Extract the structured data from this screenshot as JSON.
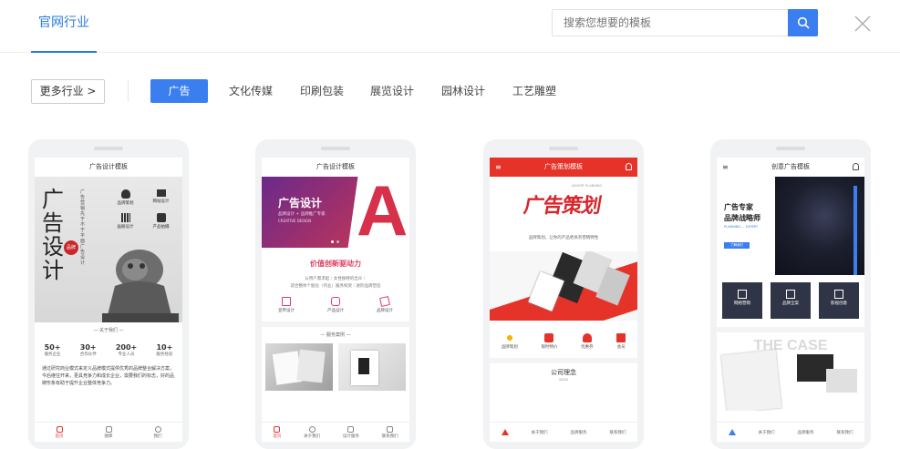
{
  "header": {
    "active_tab": "官网行业",
    "search_placeholder": "搜索您想要的模板"
  },
  "filter": {
    "more_label": "更多行业 >",
    "chips": [
      "广告",
      "文化传媒",
      "印刷包装",
      "展览设计",
      "园林设计",
      "工艺雕塑"
    ],
    "active_index": 0
  },
  "colors": {
    "accent": "#3a7ef0",
    "red": "#e5332a"
  },
  "templates": [
    {
      "title": "广告设计模板",
      "hero_vertical_text": "广告设计",
      "hero_stamp": "品牌",
      "hero_caption": "广告营销先于不于平面广告设计",
      "icons": [
        "品牌策划",
        "网站设计",
        "画册设计",
        "产品拍摄"
      ],
      "about_label": "关于我们",
      "stats": [
        {
          "value": "50+",
          "label": "服务企业"
        },
        {
          "value": "30+",
          "label": "合作伙伴"
        },
        {
          "value": "200+",
          "label": "专业人员"
        },
        {
          "value": "10+",
          "label": "服务经验"
        }
      ],
      "paragraph": "通过研究商业模式来定义品牌模式提供优秀的品牌整合解决方案，今后继往开来，更具竞争力和成长企业，需要我们的标志，好的品牌形象有助于提升企业整体竞争力。",
      "nav": [
        "首页",
        "图库",
        "我们"
      ]
    },
    {
      "title": "广告设计模板",
      "banner_title": "广告设计",
      "banner_sub": "品牌设计 + 品牌推广专家",
      "banner_sub2": "CREATIVE DESIGN",
      "banner_letter": "A",
      "headline": "价值创新驱动力",
      "tagline1": "从用户需求起｜女性独特的出众｜",
      "tagline2": "适合整体个股化（作业）服务构架｜进阶品牌塑造",
      "services": [
        "宣传设计",
        "产品设计",
        "品牌设计"
      ],
      "case_label": "服务案例",
      "nav": [
        "首页",
        "关于我们",
        "设计服务",
        "联系我们"
      ]
    },
    {
      "title": "广告策划模板",
      "hero_text": "广告策划",
      "hero_en": "ADVERT PLANNING",
      "hero_sub": "品牌策划，让你的产品更具有营销特性",
      "icons": [
        "品牌策划",
        "限时特价",
        "优惠券",
        "会员"
      ],
      "section": "公司理念",
      "section_en": "IDEAS",
      "nav": [
        "关于我们",
        "品牌服务",
        "联系我们"
      ]
    },
    {
      "title": "创意广告模板",
      "hero_title1": "广告专家",
      "hero_title2": "品牌战略师",
      "hero_en": "PLANNING — EXPERT",
      "hero_btn": "了解我们",
      "features": [
        "网络营销",
        "品牌全案",
        "影视创意"
      ],
      "case_text": "THE CASE",
      "nav": [
        "关于我们",
        "品牌服务",
        "联系我们"
      ]
    }
  ]
}
